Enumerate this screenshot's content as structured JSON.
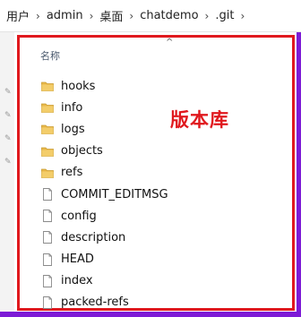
{
  "breadcrumb": {
    "items": [
      "用户",
      "admin",
      "桌面",
      "chatdemo",
      ".git"
    ],
    "separator": "›"
  },
  "list": {
    "column_header": "名称",
    "sort_indicator": "^",
    "items": [
      {
        "name": "hooks",
        "type": "folder"
      },
      {
        "name": "info",
        "type": "folder"
      },
      {
        "name": "logs",
        "type": "folder"
      },
      {
        "name": "objects",
        "type": "folder"
      },
      {
        "name": "refs",
        "type": "folder"
      },
      {
        "name": "COMMIT_EDITMSG",
        "type": "file"
      },
      {
        "name": "config",
        "type": "file"
      },
      {
        "name": "description",
        "type": "file"
      },
      {
        "name": "HEAD",
        "type": "file"
      },
      {
        "name": "index",
        "type": "file"
      },
      {
        "name": "packed-refs",
        "type": "file"
      }
    ]
  },
  "annotation": {
    "label": "版本库",
    "color": "#e0191e"
  },
  "colors": {
    "background": "#7d1bd6",
    "highlight_frame": "#e0191e",
    "folder": "#e8b84a"
  }
}
